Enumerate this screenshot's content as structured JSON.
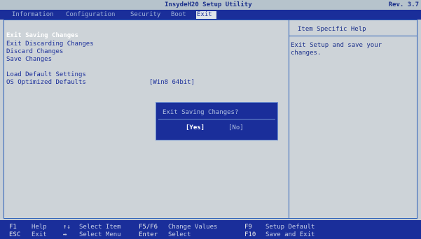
{
  "title": {
    "text": "InsydeH20 Setup Utility",
    "revision": "Rev. 3.7"
  },
  "menu": [
    {
      "label": "Information"
    },
    {
      "label": "Configuration"
    },
    {
      "label": "Security"
    },
    {
      "label": "Boot"
    },
    {
      "label": "Exit"
    }
  ],
  "options": {
    "exit_saving": "Exit Saving Changes",
    "exit_discarding": "Exit Discarding Changes",
    "discard": "Discard Changes",
    "save": "Save Changes",
    "load_default": "Load Default Settings",
    "os_optimized": "OS Optimized Defaults",
    "os_optimized_value": "[Win8 64bit]"
  },
  "help": {
    "heading": "Item Specific Help",
    "text": "Exit Setup and save your changes."
  },
  "dialog": {
    "title": "Exit Saving Changes?",
    "yes": "[Yes]",
    "no": "[No]"
  },
  "footer": {
    "f1_key": "F1",
    "f1_desc": "Help",
    "esc_key": "ESC",
    "esc_desc": "Exit",
    "updown_key": "↑↓",
    "updown_desc": "Select Item",
    "leftright_key": "↔",
    "leftright_desc": "Select Menu",
    "f5f6_key": "F5/F6",
    "f5f6_desc": "Change Values",
    "enter_key": "Enter",
    "enter_desc": "Select",
    "f9_key": "F9",
    "f9_desc": "Setup Default",
    "f10_key": "F10",
    "f10_desc": "Save and Exit"
  },
  "colors": {
    "menu_bg": "#1a2e9a",
    "panel_bg": "#cdd3d8",
    "text_blue": "#1a2e9a",
    "selected_text": "#ffffff"
  }
}
